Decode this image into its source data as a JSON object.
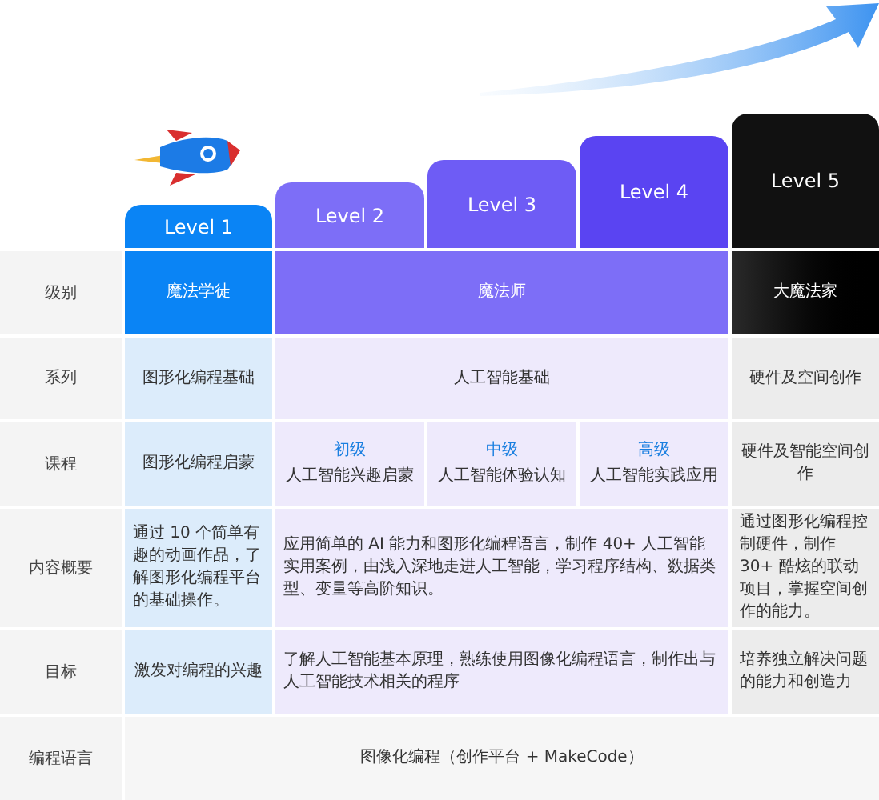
{
  "levels": [
    {
      "label": "Level 1",
      "color": "#0a84f5"
    },
    {
      "label": "Level 2",
      "color": "#7d6ef7"
    },
    {
      "label": "Level 3",
      "color": "#6e5cf5"
    },
    {
      "label": "Level 4",
      "color": "#5a44f2"
    },
    {
      "label": "Level 5",
      "color": "#111111"
    }
  ],
  "rows": [
    {
      "label": "级别",
      "kind": "tier",
      "cells": [
        {
          "kind": "beginner",
          "text": "魔法学徒"
        },
        {
          "kind": "ai",
          "text": "魔法师"
        },
        {
          "kind": "hardware",
          "text": "大魔法家"
        }
      ]
    },
    {
      "label": "系列",
      "kind": "info",
      "cells": [
        {
          "kind": "beginner",
          "text": "图形化编程基础"
        },
        {
          "kind": "ai",
          "text": "人工智能基础"
        },
        {
          "kind": "hardware",
          "text": "硬件及空间创作"
        }
      ]
    },
    {
      "label": "课程",
      "kind": "info",
      "cells": [
        {
          "kind": "beginner",
          "text": "图形化编程启蒙"
        },
        {
          "kind": "ai",
          "parts": [
            {
              "grade": "初级",
              "text": "人工智能兴趣启蒙"
            },
            {
              "grade": "中级",
              "text": "人工智能体验认知"
            },
            {
              "grade": "高级",
              "text": "人工智能实践应用"
            }
          ]
        },
        {
          "kind": "hardware",
          "text": "硬件及智能空间创作"
        }
      ]
    },
    {
      "label": "内容概要",
      "kind": "info",
      "cells": [
        {
          "kind": "beginner",
          "text": "通过 10 个简单有趣的动画作品，了解图形化编程平台的基础操作。"
        },
        {
          "kind": "ai",
          "text": "应用简单的 AI 能力和图形化编程语言，制作 40+ 人工智能实用案例，由浅入深地走进人工智能，学习程序结构、数据类型、变量等高阶知识。"
        },
        {
          "kind": "hardware",
          "text": "通过图形化编程控制硬件，制作 30+ 酷炫的联动项目，掌握空间创作的能力。"
        }
      ]
    },
    {
      "label": "目标",
      "kind": "info",
      "cells": [
        {
          "kind": "beginner",
          "text": "激发对编程的兴趣"
        },
        {
          "kind": "ai",
          "text": "了解人工智能基本原理，熟练使用图像化编程语言，制作出与人工智能技术相关的程序"
        },
        {
          "kind": "hardware",
          "text": "培养独立解决问题的能力和创造力"
        }
      ]
    },
    {
      "label": "编程语言",
      "kind": "info",
      "cells": [
        {
          "kind": "all",
          "text": "图像化编程（创作平台 + MakeCode）"
        }
      ]
    }
  ]
}
